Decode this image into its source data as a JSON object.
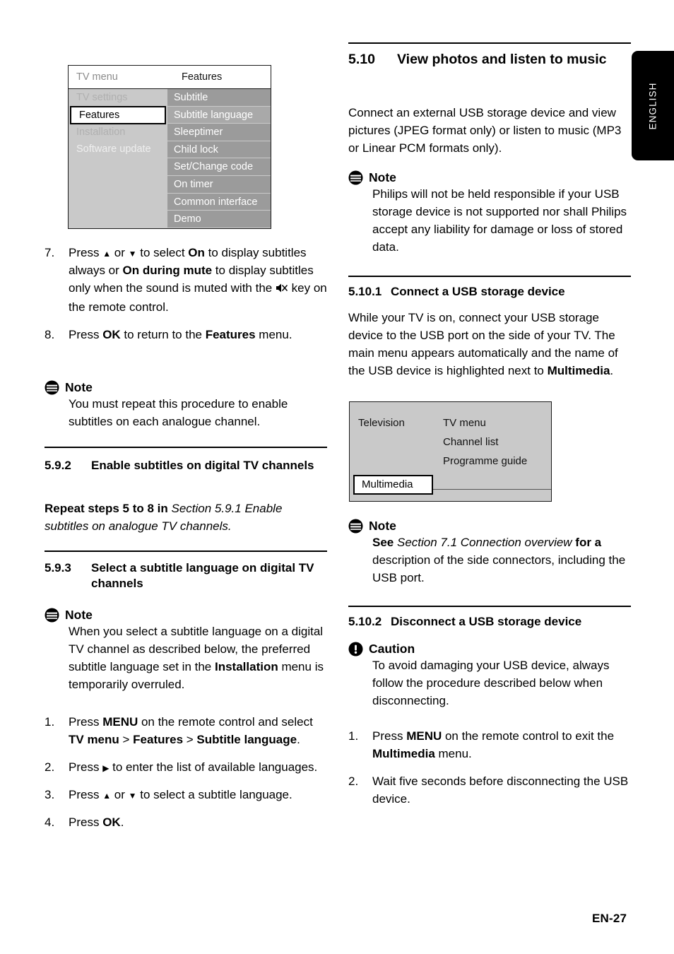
{
  "page": {
    "language_tab": "ENGLISH",
    "page_number": "EN-27"
  },
  "tv_menu_diagram": {
    "header": {
      "left": "TV menu",
      "right": "Features"
    },
    "left_column": [
      "TV settings",
      "Features",
      "Installation",
      "Software update"
    ],
    "left_selected": "Features",
    "right_column": [
      "Subtitle",
      "Subtitle language",
      "Sleeptimer",
      "Child lock",
      "Set/Change code",
      "On timer",
      "Common interface",
      "Demo"
    ],
    "right_highlighted": "Subtitle language"
  },
  "main_menu_diagram": {
    "left_label": "Television",
    "right_items": [
      "TV menu",
      "Channel list",
      "Programme guide"
    ],
    "selected": "Multimedia"
  },
  "left_column": {
    "step7": {
      "number": "7.",
      "part1": "Press ",
      "up_arrow": "▲",
      "part2": " or ",
      "down_arrow": "▼",
      "part3": " to select ",
      "bold1": "On",
      "part4": " to display subtitles always or ",
      "bold2": "On during mute",
      "part5": " to display subtitles only when the sound is muted with the ",
      "mute_icon": "mute-key-icon",
      "part6": " key on the remote control."
    },
    "step8": {
      "number": "8.",
      "part1": "Press ",
      "bold1": "OK",
      "part2": " to return to the ",
      "bold2": "Features",
      "part3": " menu."
    },
    "note1": {
      "title": "Note",
      "text": "You must repeat this procedure to enable subtitles on each analogue channel."
    },
    "section_592": {
      "number": "5.9.2",
      "title": "Enable subtitles on digital TV channels",
      "body_bold": "Repeat steps 5 to 8 in ",
      "body_italic": "Section 5.9.1 Enable subtitles on analogue TV channels",
      "body_end": "."
    },
    "section_593": {
      "number": "5.9.3",
      "title": "Select a subtitle language on digital TV channels"
    },
    "note2": {
      "title": "Note",
      "part1": "When you select a subtitle language on a digital TV channel as described below, the preferred subtitle language set in the ",
      "bold1": "Installation",
      "part2": " menu is temporarily overruled."
    },
    "steps": [
      {
        "number": "1.",
        "part1": "Press ",
        "bold1": "MENU",
        "part2": " on the remote control and select ",
        "bold2": "TV menu",
        "part3": " > ",
        "bold3": "Features",
        "part4": " > ",
        "bold4": "Subtitle language",
        "part5": "."
      },
      {
        "number": "2.",
        "part1": "Press ",
        "arrow": "▶",
        "part2": " to enter the list of available languages."
      },
      {
        "number": "3.",
        "part1": "Press ",
        "up_arrow": "▲",
        "part2": " or ",
        "down_arrow": "▼",
        "part3": " to select a subtitle language."
      },
      {
        "number": "4.",
        "part1": "Press ",
        "bold1": "OK",
        "part2": "."
      }
    ]
  },
  "right_column": {
    "section_510": {
      "number": "5.10",
      "title": "View photos and listen to music",
      "body": "Connect an external USB storage device and view pictures (JPEG format only) or listen to music (MP3 or Linear PCM formats only)."
    },
    "note1": {
      "title": "Note",
      "text": "Philips will not be held responsible if your USB storage device is not supported nor shall Philips accept any liability for damage or loss of stored data."
    },
    "section_5101": {
      "number": "5.10.1",
      "title": "Connect a USB storage device",
      "part1": "While your TV is on, connect your USB storage device to the USB port on the side of your TV. The main menu appears automatically and the name of the USB device is highlighted next to ",
      "bold1": "Multimedia",
      "part2": "."
    },
    "note2": {
      "title": "Note",
      "part1": "See ",
      "italic1": "Section 7.1 Connection overview",
      "bold1": " for a",
      "part2": " description of the side connectors, including the USB port."
    },
    "section_5102": {
      "number": "5.10.2",
      "title": "Disconnect a USB storage device"
    },
    "caution": {
      "title": "Caution",
      "text": "To avoid damaging your USB device, always follow the procedure described below when disconnecting."
    },
    "steps": [
      {
        "number": "1.",
        "part1": "Press ",
        "bold1": "MENU",
        "part2": " on the remote control to exit the ",
        "bold2": "Multimedia",
        "part3": " menu."
      },
      {
        "number": "2.",
        "part1": "Wait five seconds before disconnecting the USB device."
      }
    ]
  }
}
